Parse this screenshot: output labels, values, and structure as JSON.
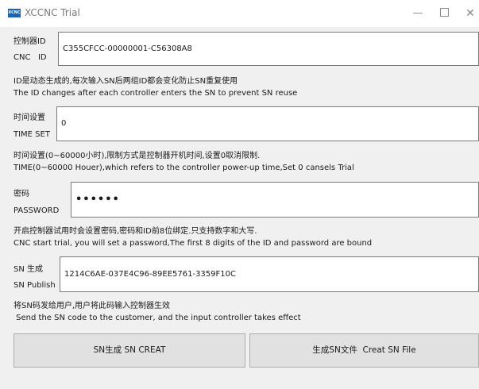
{
  "window": {
    "icon_text": "XCNC",
    "title": "XCCNC Trial",
    "minimize": "—",
    "close": "✕"
  },
  "controller_id": {
    "label_cn": "控制器ID",
    "label_en": "CNC   ID",
    "value": "C355CFCC-00000001-C56308A8",
    "note_cn": "ID是动态生成的,每次输入SN后两组ID都会变化防止SN重复使用",
    "note_en": "The ID changes after each controller enters the SN to prevent SN reuse"
  },
  "time_set": {
    "label_cn": "时间设置",
    "label_en": "TIME SET",
    "value": "0",
    "note_cn": "时间设置(0~60000小时),限制方式是控制器开机时间,设置0取消限制.",
    "note_en": "TIME(0~60000 Houer),which refers to the controller power-up time,Set 0 cansels Trial"
  },
  "password": {
    "label_cn": "密码",
    "label_en": "PASSWORD",
    "value": "••••••",
    "note_cn": "开启控制器试用时会设置密码,密码和ID前8位绑定.只支持数字和大写.",
    "note_en": "CNC start trial, you will set a password,The first 8 digits of the ID and password are bound"
  },
  "sn": {
    "label_cn": "SN 生成",
    "label_en": "SN Publish",
    "value": "1214C6AE-037E4C96-89EE5761-3359F10C",
    "note_cn": "将SN码发给用户,用户将此码输入控制器生效",
    "note_en": " Send the SN code to the customer, and the input controller takes effect"
  },
  "buttons": {
    "sn_create": "SN生成 SN CREAT",
    "sn_file": "生成SN文件  Creat SN File"
  }
}
